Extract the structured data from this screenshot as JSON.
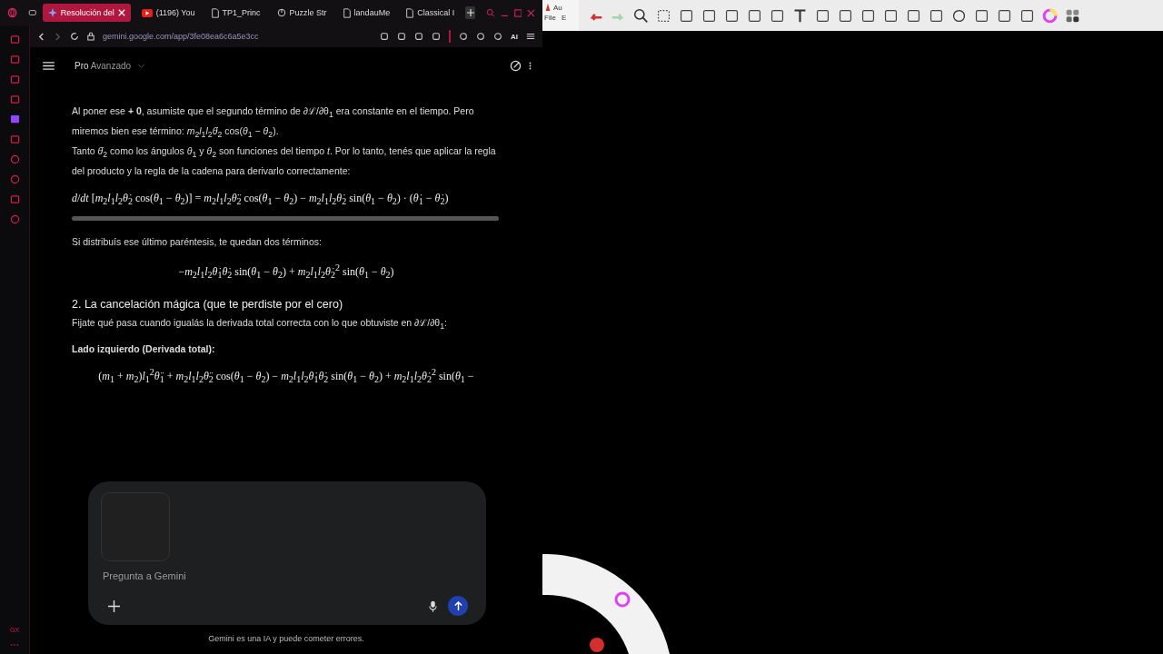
{
  "browser": {
    "tabs": [
      {
        "label": "Resolución del",
        "kind": "gemini",
        "selected": true
      },
      {
        "label": "(1196) You",
        "kind": "video",
        "selected": false
      },
      {
        "label": "TP1_Princ",
        "kind": "doc",
        "selected": false
      },
      {
        "label": "Puzzle Str",
        "kind": "puzzle",
        "selected": false
      },
      {
        "label": "landauMe",
        "kind": "doc",
        "selected": false
      },
      {
        "label": "Classical I",
        "kind": "doc",
        "selected": false
      }
    ],
    "url": "gemini.google.com/app/3fe08ea6c6a5e3cc",
    "ai_label": "AI",
    "sidebar_label": "GX"
  },
  "gemini": {
    "model_prefix": "Pro",
    "model": "Avanzado",
    "blocks": [
      {
        "kind": "paragraph",
        "lines": [
          "Al poner ese **+ 0**, asumiste que el segundo término de ∂ℒ/∂θ$_{1}$ era constante en el tiempo. Pero miremos bien ese término: *m*$_{2}$*l*$_{1}$*l*$_{2}$*θ̇*$_{2}$ cos(*θ*$_{1}$ − *θ*$_{2}$).",
          "Tanto *θ̇*$_{2}$ como los ángulos *θ*$_{1}$ y *θ*$_{2}$ son funciones del tiempo *t*. Por lo tanto, tenés que aplicar la regla del producto y la regla de la cadena para derivarlo correctamente:"
        ]
      },
      {
        "kind": "equation",
        "scroll": true,
        "text": "*d*/*dt* [*m*$_{2}$*l*$_{1}$*l*$_{2}$*θ̇*$_{2}$ cos(*θ*$_{1}$ − *θ*$_{2}$)] = *m*$_{2}$*l*$_{1}$*l*$_{2}$*θ̈*$_{2}$ cos(*θ*$_{1}$ − *θ*$_{2}$) − *m*$_{2}$*l*$_{1}$*l*$_{2}$*θ̇*$_{2}$ sin(*θ*$_{1}$ − *θ*$_{2}$) · (*θ̇*$_{1}$ − *θ̇*$_{2}$)"
      },
      {
        "kind": "paragraph",
        "lines": [
          "Si distribuís ese último paréntesis, te quedan dos términos:"
        ]
      },
      {
        "kind": "equation",
        "scroll": false,
        "text": "−*m*$_{2}$*l*$_{1}$*l*$_{2}$*θ̇*$_{1}$*θ̇*$_{2}$ sin(*θ*$_{1}$ − *θ*$_{2}$) + *m*$_{2}$*l*$_{1}$*l*$_{2}$*θ̇*$_{2}$$^{2}$ sin(*θ*$_{1}$ − *θ*$_{2}$)"
      },
      {
        "kind": "heading",
        "lines": [
          "2. La cancelación mágica (que te perdiste por el cero)"
        ]
      },
      {
        "kind": "paragraph",
        "lines": [
          "Fijate qué pasa cuando igualás la derivada total correcta con lo que obtuviste en ∂ℒ/∂θ$_{1}$:"
        ]
      },
      {
        "kind": "label",
        "lines": [
          "Lado izquierdo (Derivada total):"
        ]
      },
      {
        "kind": "equation",
        "scroll": false,
        "text": "(*m*$_{1}$ + *m*$_{2}$)*l*$_{1}$$^{2}$*θ̈*$_{1}$ + *m*$_{2}$*l*$_{1}$*l*$_{2}$*θ̈*$_{2}$ cos(*θ*$_{1}$ − *θ*$_{2}$) − *m*$_{2}$*l*$_{1}$*l*$_{2}$*θ̇*$_{1}$*θ̇*$_{2}$ sin(*θ*$_{1}$ − *θ*$_{2}$) + *m*$_{2}$*l*$_{1}$*l*$_{2}$*θ̇*$_{2}$$^{2}$ sin(*θ*$_{1}$ −"
      }
    ],
    "input": {
      "placeholder": "Pregunta a Gemini",
      "has_attachment": true
    },
    "disclaimer": "Gemini es una IA y puede cometer errores."
  },
  "notes_app": {
    "title": "Au",
    "menus": [
      "File",
      "E"
    ]
  }
}
